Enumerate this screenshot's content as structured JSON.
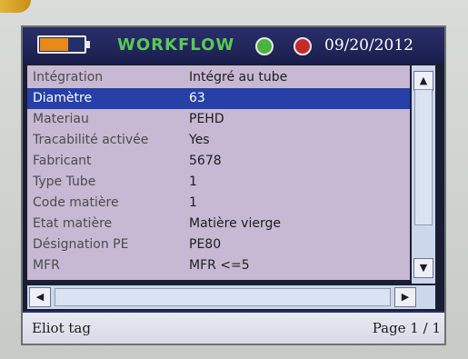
{
  "titlebar": {
    "battery_level": 0.65,
    "battery_color": "#e88a1a",
    "mode_label": "WORKFLOW",
    "status_green_color": "#49b53e",
    "status_red_color": "#c72a2a",
    "date": "09/20/2012"
  },
  "fields": [
    {
      "label": "Intégration",
      "value": "Intégré au tube"
    },
    {
      "label": "Diamètre",
      "value": "63"
    },
    {
      "label": "Materiau",
      "value": "PEHD"
    },
    {
      "label": "Tracabilité activée",
      "value": "Yes"
    },
    {
      "label": "Fabricant",
      "value": "5678"
    },
    {
      "label": "Type Tube",
      "value": "1"
    },
    {
      "label": "Code matière",
      "value": "1"
    },
    {
      "label": "Etat matière",
      "value": "Matière vierge"
    },
    {
      "label": "Désignation PE",
      "value": "PE80"
    },
    {
      "label": "MFR",
      "value": "MFR <=5"
    }
  ],
  "selected_index": 1,
  "selection_color": "#2640a8",
  "scroll": {
    "up_icon": "arrow-up-icon",
    "down_icon": "arrow-down-icon",
    "left_icon": "arrow-left-icon",
    "right_icon": "arrow-right-icon"
  },
  "footer": {
    "left_label": "Eliot tag",
    "page_label": "Page 1 / 1"
  }
}
